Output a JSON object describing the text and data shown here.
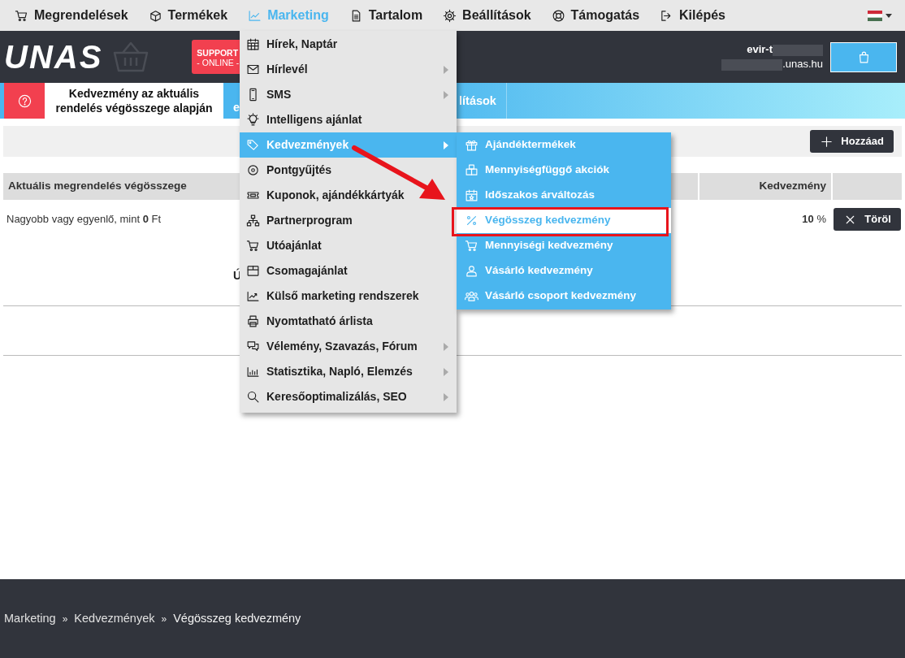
{
  "top_nav": {
    "items": [
      {
        "label": "Megrendelések",
        "selected": false
      },
      {
        "label": "Termékek",
        "selected": false
      },
      {
        "label": "Marketing",
        "selected": true
      },
      {
        "label": "Tartalom",
        "selected": false
      },
      {
        "label": "Beállítások",
        "selected": false
      },
      {
        "label": "Támogatás",
        "selected": false
      },
      {
        "label": "Kilépés",
        "selected": false
      }
    ]
  },
  "header": {
    "logo": "UNAS",
    "support": {
      "title": "SUPPORT",
      "subtitle": "- ONLINE -"
    },
    "account": {
      "user": "evir-t",
      "domain": ".unas.hu"
    }
  },
  "tabs": [
    {
      "label": "Kedvezmény az aktuális rendelés végösszege alapján",
      "selected": true
    },
    {
      "label": "e",
      "selected": false
    },
    {
      "label": "lítások",
      "selected": false
    }
  ],
  "toolbar": {
    "add_button": "Hozzáad"
  },
  "table": {
    "columns": [
      "Aktuális megrendelés végösszege",
      "Kedvezmény"
    ],
    "rows": [
      {
        "condition": "Nagyobb vagy egyenlő, mint **0** Ft",
        "discount": "**10** %",
        "delete_button": "Töröl"
      }
    ]
  },
  "partial_text": "Ú",
  "menu": {
    "items": [
      {
        "label": "Hírek, Naptár",
        "submenu": false,
        "selected": false
      },
      {
        "label": "Hírlevél",
        "submenu": true,
        "selected": false
      },
      {
        "label": "SMS",
        "submenu": true,
        "selected": false
      },
      {
        "label": "Intelligens ajánlat",
        "submenu": false,
        "selected": false
      },
      {
        "label": "Kedvezmények",
        "submenu": true,
        "selected": true
      },
      {
        "label": "Pontgyűjtés",
        "submenu": false,
        "selected": false
      },
      {
        "label": "Kuponok, ajándékkártyák",
        "submenu": false,
        "selected": false
      },
      {
        "label": "Partnerprogram",
        "submenu": false,
        "selected": false
      },
      {
        "label": "Utóajánlat",
        "submenu": false,
        "selected": false
      },
      {
        "label": "Csomagajánlat",
        "submenu": false,
        "selected": false
      },
      {
        "label": "Külső marketing rendszerek",
        "submenu": false,
        "selected": false
      },
      {
        "label": "Nyomtatható árlista",
        "submenu": false,
        "selected": false
      },
      {
        "label": "Vélemény, Szavazás, Fórum",
        "submenu": true,
        "selected": false
      },
      {
        "label": "Statisztika, Napló, Elemzés",
        "submenu": true,
        "selected": false
      },
      {
        "label": "Keresőoptimalizálás, SEO",
        "submenu": true,
        "selected": false
      }
    ]
  },
  "submenu": {
    "items": [
      {
        "label": "Ajándéktermékek",
        "selected": false
      },
      {
        "label": "Mennyiségfüggő akciók",
        "selected": false
      },
      {
        "label": "Időszakos árváltozás",
        "selected": false
      },
      {
        "label": "Végösszeg kedvezmény",
        "selected": true
      },
      {
        "label": "Mennyiségi kedvezmény",
        "selected": false
      },
      {
        "label": "Vásárló kedvezmény",
        "selected": false
      },
      {
        "label": "Vásárló csoport kedvezmény",
        "selected": false
      }
    ]
  },
  "breadcrumb": [
    {
      "kind": "link",
      "label": "Marketing"
    },
    {
      "kind": "separator",
      "label": "»"
    },
    {
      "kind": "link",
      "label": "Kedvezmények"
    },
    {
      "kind": "separator",
      "label": "»"
    },
    {
      "kind": "current",
      "label": "Végösszeg kedvezmény"
    }
  ]
}
